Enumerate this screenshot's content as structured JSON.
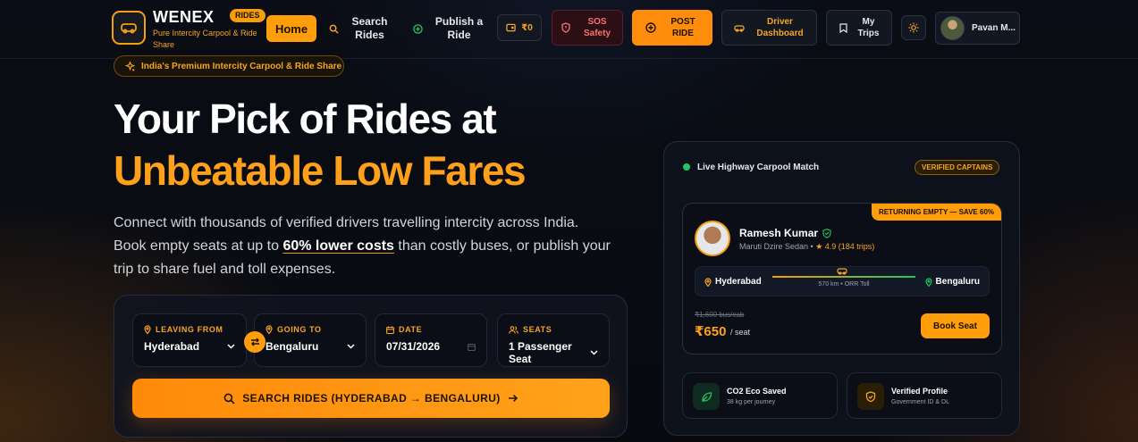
{
  "brand": {
    "name": "WENEX",
    "badge": "RIDES",
    "tagline": "Pure Intercity Carpool & Ride Share"
  },
  "nav": {
    "home": "Home",
    "search": "Search Rides",
    "publish": "Publish a Ride",
    "wallet": "₹0",
    "sos": "SOS Safety",
    "post": "POST RIDE",
    "driver": "Driver Dashboard",
    "trips": "My Trips",
    "profile": "Pavan M..."
  },
  "hero": {
    "chip": "India's Premium Intercity Carpool & Ride Share",
    "title_line1": "Your Pick of Rides at",
    "title_line2": "Unbeatable Low Fares",
    "desc_before": "Connect with thousands of verified drivers travelling intercity across India. Book empty seats at up to ",
    "desc_highlight": "60% lower costs",
    "desc_after": " than costly buses, or publish your trip to share fuel and toll expenses."
  },
  "search": {
    "from_label": "LEAVING FROM",
    "from_value": "Hyderabad",
    "to_label": "GOING TO",
    "to_value": "Bengaluru",
    "date_label": "DATE",
    "date_value": "07/31/2026",
    "seats_label": "SEATS",
    "seats_value": "1 Passenger Seat",
    "button": "SEARCH RIDES (HYDERABAD → BENGALURU)"
  },
  "match": {
    "live_title": "Live Highway Carpool Match",
    "verified_chip": "VERIFIED CAPTAINS",
    "returning": "RETURNING EMPTY — SAVE 60%",
    "driver_name": "Ramesh Kumar",
    "driver_car": "Maruti Dzire Sedan •",
    "driver_rating": "★ 4.9 (184 trips)",
    "route_from": "Hyderabad",
    "route_to": "Bengaluru",
    "route_dist": "570 km • ORR Toll",
    "old_price": "₹1,600 bus/cab",
    "new_price": "₹650",
    "per_seat": "/ seat",
    "book": "Book Seat",
    "eco_title": "CO2 Eco Saved",
    "eco_sub": "38 kg per journey",
    "ver_title": "Verified Profile",
    "ver_sub": "Government ID & DL"
  },
  "colors": {
    "accent": "#ff9d0a",
    "accent_text": "#f5a524",
    "success": "#22c55e",
    "danger": "#f87171",
    "background": "#07090f"
  }
}
